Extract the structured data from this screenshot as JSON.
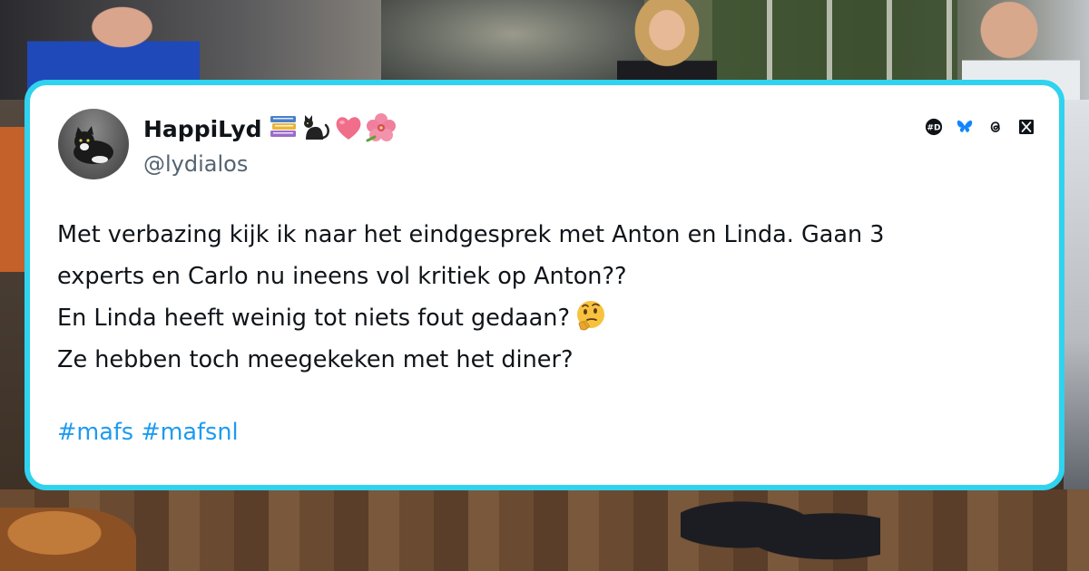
{
  "tweet": {
    "display_name": "HappiLyd",
    "name_emojis": [
      "books-emoji",
      "black-cat-emoji",
      "pink-heart-emoji",
      "hibiscus-emoji"
    ],
    "handle": "@lydialos",
    "lines": [
      "Met verbazing kijk ik naar het eindgesprek met Anton en Linda. Gaan 3",
      "experts en Carlo nu ineens vol kritiek op Anton??",
      "En Linda heeft weinig tot niets fout gedaan?",
      "Ze hebben toch meegekeken met het diner?"
    ],
    "inline_emoji": "thinking-face-emoji",
    "hashtags": [
      "#mafs",
      "#mafsnl"
    ]
  },
  "platforms": [
    "dlvr-icon",
    "bluesky-icon",
    "threads-icon",
    "x-icon"
  ],
  "colors": {
    "card_border": "#2fd3ef",
    "hashtag": "#1d9bf0",
    "text": "#0f1419",
    "handle": "#536471"
  }
}
